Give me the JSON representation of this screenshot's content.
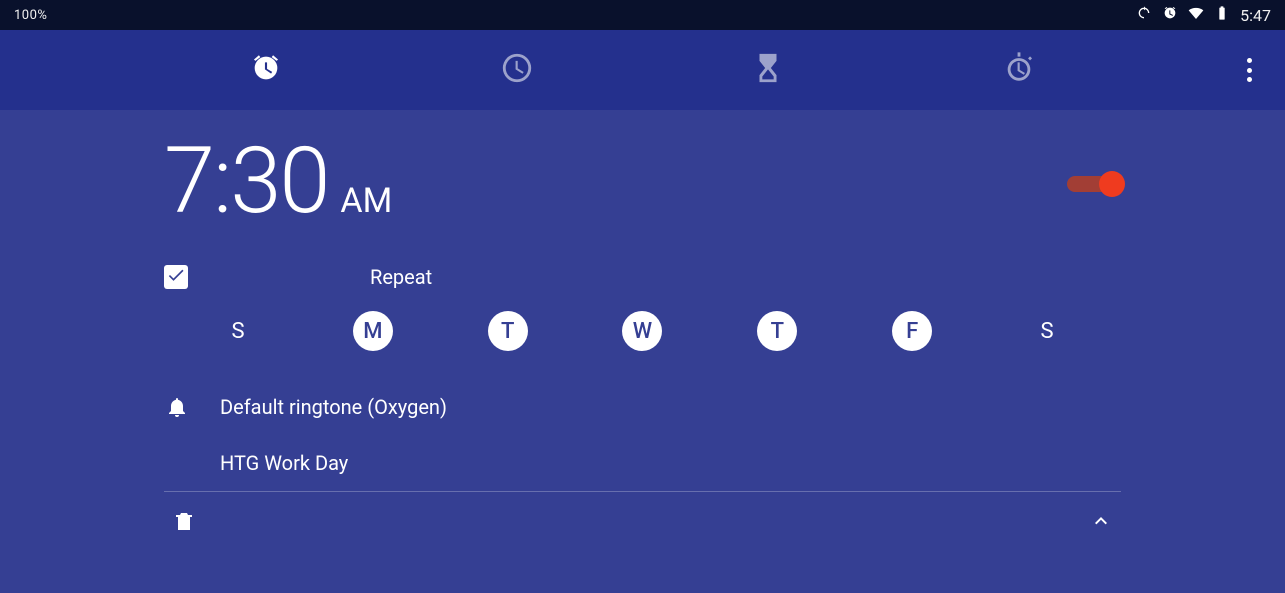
{
  "statusbar": {
    "left_text": "100%",
    "time": "5:47"
  },
  "alarm": {
    "time": "7:30",
    "ampm": "AM",
    "enabled": true,
    "repeat_checked": true,
    "repeat_label": "Repeat",
    "days": [
      {
        "letter": "S",
        "on": false
      },
      {
        "letter": "M",
        "on": true
      },
      {
        "letter": "T",
        "on": true
      },
      {
        "letter": "W",
        "on": true
      },
      {
        "letter": "T",
        "on": true
      },
      {
        "letter": "F",
        "on": true
      },
      {
        "letter": "S",
        "on": false
      }
    ],
    "ringtone": "Default ringtone (Oxygen)",
    "label": "HTG Work Day"
  }
}
